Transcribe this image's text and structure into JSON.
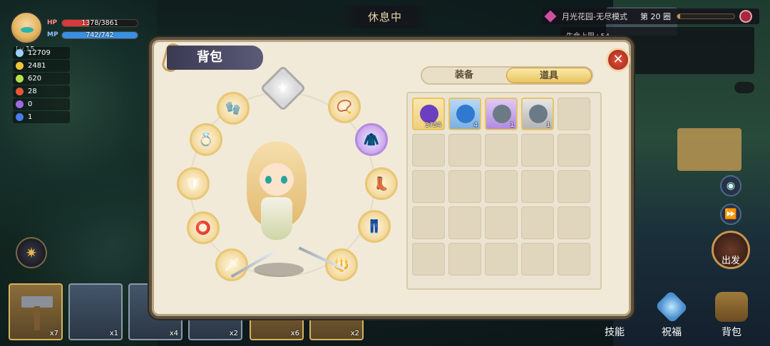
{
  "player": {
    "level": "Lv.15",
    "hp_label": "HP",
    "hp_value": "1378/3861",
    "hp_ratio": 0.357,
    "mp_label": "MP",
    "mp_value": "742/742",
    "mp_ratio": 1.0
  },
  "resources": [
    {
      "icon": "sword-icon",
      "value": "12709",
      "color": "#9ad1ff"
    },
    {
      "icon": "gold-coin-icon",
      "value": "2481",
      "color": "#f1c33a"
    },
    {
      "icon": "green-gem-icon",
      "value": "620",
      "color": "#b7e04a"
    },
    {
      "icon": "red-heart-icon",
      "value": "28",
      "color": "#e6563b"
    },
    {
      "icon": "purple-cat-icon",
      "value": "0",
      "color": "#9c6ae2"
    },
    {
      "icon": "question-icon",
      "value": "1",
      "color": "#4a7be8"
    }
  ],
  "status": "休息中",
  "stage": {
    "name": "月光花园-无尽模式",
    "round_label": "第 20 圈",
    "progress": 0.05,
    "buff": "生命上限+54"
  },
  "panel": {
    "title": "背包",
    "close": "✕",
    "tabs": [
      {
        "label": "装备",
        "active": false
      },
      {
        "label": "道具",
        "active": true
      }
    ]
  },
  "inventory": [
    {
      "icon": "purple-crystal-icon",
      "qty": "3754",
      "style": "gold",
      "color": "#6b3fc0"
    },
    {
      "icon": "water-bottle-icon",
      "qty": "4",
      "style": "blue",
      "color": "#2f79d1"
    },
    {
      "icon": "treasure-chest-icon",
      "qty": "1",
      "style": "purple",
      "color": "#6c7a86"
    },
    {
      "icon": "treasure-chest-icon",
      "qty": "1",
      "style": "silver",
      "color": "#6c7a86"
    }
  ],
  "empty_cells": 21,
  "bottom_cards": [
    {
      "count": "x7",
      "style": "gold"
    },
    {
      "count": "x1",
      "style": "blue"
    },
    {
      "count": "x4",
      "style": "blue"
    },
    {
      "count": "x2",
      "style": "blue"
    },
    {
      "count": "x6",
      "style": "gold"
    },
    {
      "count": "x2",
      "style": "gold"
    }
  ],
  "nav": {
    "skills": "技能",
    "blessing": "祝福",
    "bag": "背包",
    "depart": "出发"
  }
}
